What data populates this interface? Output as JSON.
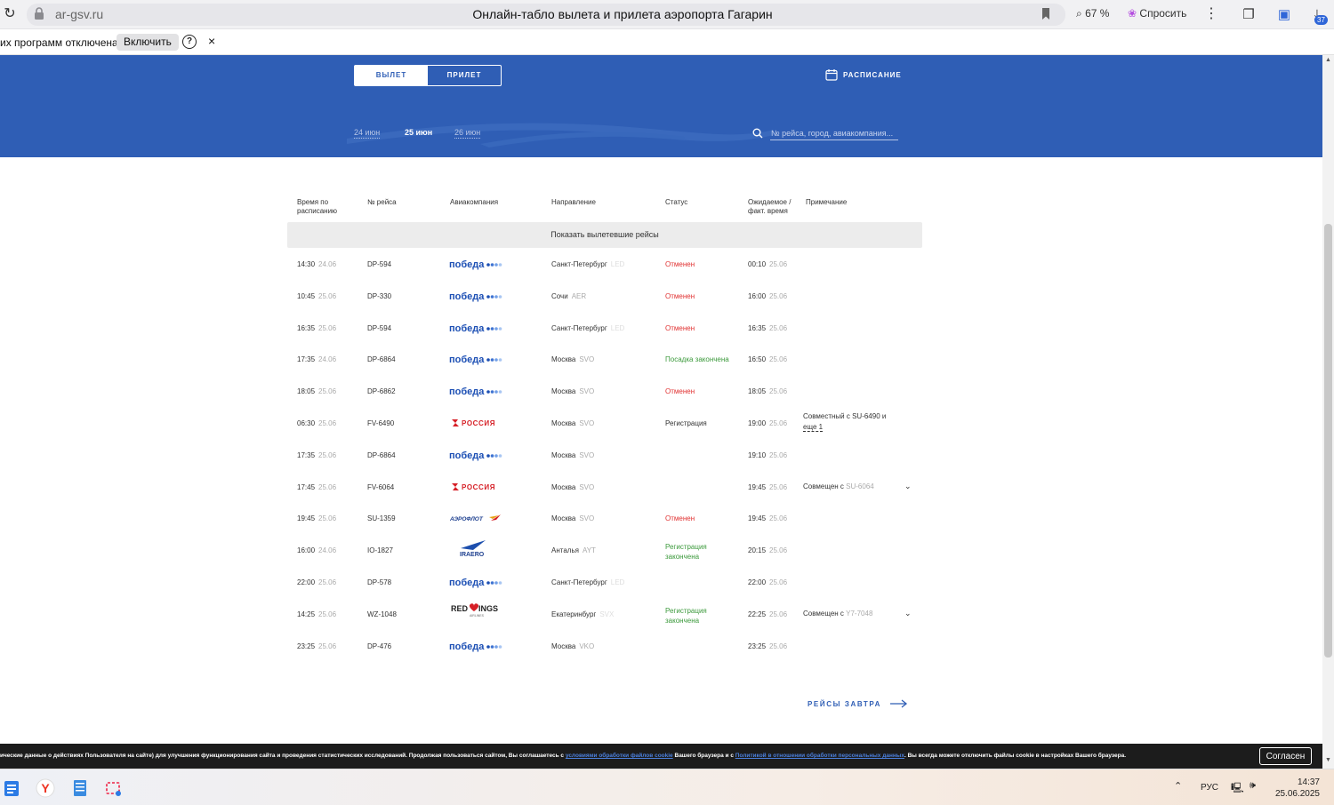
{
  "browser": {
    "domain": "ar-gsv.ru",
    "title": "Онлайн-табло вылета и прилета аэропорта Гагарин",
    "zoom": "67 %",
    "ask_label": "Спросить",
    "downloads_badge": "37"
  },
  "infobar": {
    "message": "их программ отключена",
    "enable_label": "Включить",
    "help": "?",
    "close": "×"
  },
  "header": {
    "tabs": [
      {
        "label": "ВЫЛЕТ",
        "active": true
      },
      {
        "label": "ПРИЛЕТ",
        "active": false
      }
    ],
    "schedule_label": "РАСПИСАНИЕ",
    "dates": [
      {
        "label": "24 июн",
        "current": false
      },
      {
        "label": "25 июн",
        "current": true
      },
      {
        "label": "26 июн",
        "current": false
      }
    ],
    "search_placeholder": "№ рейса, город, авиакомпания..."
  },
  "table": {
    "columns": {
      "scheduled_1": "Время по",
      "scheduled_2": "расписанию",
      "flight": "№ рейса",
      "airline": "Авиакомпания",
      "direction": "Направление",
      "status": "Статус",
      "expected_1": "Ожидаемое /",
      "expected_2": "факт. время",
      "note": "Примечание"
    },
    "show_departed": "Показать вылетевшие рейсы",
    "rows": [
      {
        "time": "14:30",
        "date": "24.06",
        "flight": "DP-594",
        "airline": "pobeda",
        "city": "Санкт-Петербург",
        "code": "LED",
        "status": "Отменен",
        "status_color": "red",
        "exp_time": "00:10",
        "exp_date": "25.06",
        "note": ""
      },
      {
        "time": "10:45",
        "date": "25.06",
        "flight": "DP-330",
        "airline": "pobeda",
        "city": "Сочи",
        "code": "AER",
        "status": "Отменен",
        "status_color": "red",
        "exp_time": "16:00",
        "exp_date": "25.06",
        "note": ""
      },
      {
        "time": "16:35",
        "date": "25.06",
        "flight": "DP-594",
        "airline": "pobeda",
        "city": "Санкт-Петербург",
        "code": "LED",
        "status": "Отменен",
        "status_color": "red",
        "exp_time": "16:35",
        "exp_date": "25.06",
        "note": ""
      },
      {
        "time": "17:35",
        "date": "24.06",
        "flight": "DP-6864",
        "airline": "pobeda",
        "city": "Москва",
        "code": "SVO",
        "status": "Посадка закончена",
        "status_color": "green",
        "exp_time": "16:50",
        "exp_date": "25.06",
        "note": ""
      },
      {
        "time": "18:05",
        "date": "25.06",
        "flight": "DP-6862",
        "airline": "pobeda",
        "city": "Москва",
        "code": "SVO",
        "status": "Отменен",
        "status_color": "red",
        "exp_time": "18:05",
        "exp_date": "25.06",
        "note": ""
      },
      {
        "time": "06:30",
        "date": "25.06",
        "flight": "FV-6490",
        "airline": "rossiya",
        "city": "Москва",
        "code": "SVO",
        "status": "Регистрация",
        "status_color": "dark",
        "exp_time": "19:00",
        "exp_date": "25.06",
        "note": "joint"
      },
      {
        "time": "17:35",
        "date": "25.06",
        "flight": "DP-6864",
        "airline": "pobeda",
        "city": "Москва",
        "code": "SVO",
        "status": "",
        "status_color": "dark",
        "exp_time": "19:10",
        "exp_date": "25.06",
        "note": ""
      },
      {
        "time": "17:45",
        "date": "25.06",
        "flight": "FV-6064",
        "airline": "rossiya",
        "city": "Москва",
        "code": "SVO",
        "status": "",
        "status_color": "dark",
        "exp_time": "19:45",
        "exp_date": "25.06",
        "note": "combined_su"
      },
      {
        "time": "19:45",
        "date": "25.06",
        "flight": "SU-1359",
        "airline": "aeroflot",
        "city": "Москва",
        "code": "SVO",
        "status": "Отменен",
        "status_color": "red",
        "exp_time": "19:45",
        "exp_date": "25.06",
        "note": ""
      },
      {
        "time": "16:00",
        "date": "24.06",
        "flight": "IO-1827",
        "airline": "iraero",
        "city": "Анталья",
        "code": "AYT",
        "status": "Регистрация",
        "status2": "закончена",
        "status_color": "green",
        "exp_time": "20:15",
        "exp_date": "25.06",
        "note": ""
      },
      {
        "time": "22:00",
        "date": "25.06",
        "flight": "DP-578",
        "airline": "pobeda",
        "city": "Санкт-Петербург",
        "code": "LED",
        "status": "",
        "status_color": "dark",
        "exp_time": "22:00",
        "exp_date": "25.06",
        "note": ""
      },
      {
        "time": "14:25",
        "date": "25.06",
        "flight": "WZ-1048",
        "airline": "redwings",
        "city": "Екатеринбург",
        "code": "SVX",
        "status": "Регистрация",
        "status2": "закончена",
        "status_color": "green",
        "exp_time": "22:25",
        "exp_date": "25.06",
        "note": "combined_y7"
      },
      {
        "time": "23:25",
        "date": "25.06",
        "flight": "DP-476",
        "airline": "pobeda",
        "city": "Москва",
        "code": "VKO",
        "status": "",
        "status_color": "dark",
        "exp_time": "23:25",
        "exp_date": "25.06",
        "note": ""
      }
    ],
    "notes": {
      "joint_1": "Совместный с SU-6490  и",
      "joint_2": "еще 1",
      "combined_prefix": "Совмещен с",
      "combined_su": "SU-6064",
      "combined_y7": "Y7-7048"
    },
    "logos": {
      "pobeda": "победа",
      "rossiya": "РОССИЯ",
      "aeroflot": "АЭРОФЛОТ",
      "iraero": "IRAERO",
      "redwings_1": "RED",
      "redwings_2": "INGS",
      "redwings_sub": "AIRLINES"
    }
  },
  "tomorrow_label": "РЕЙСЫ ЗАВТРА",
  "cookie": {
    "text_1": "ические данные о действиях Пользователя на сайте) для улучшения функционирования сайта и проведения статистических исследований. Продолжая пользоваться сайтом, Вы соглашаетесь с ",
    "link_1": "условиями обработки файлов cookie",
    "text_2": " Вашего браузера и с ",
    "link_2": "Политикой в отношении обработки персональных данных",
    "text_3": ". Вы всегда можете отключить файлы cookie в настройках Вашего браузера.",
    "agree_label": "Согласен"
  },
  "taskbar": {
    "lang": "РУС",
    "time": "14:37",
    "date": "25.06.2025"
  },
  "colors": {
    "brand_blue": "#2f5eb5",
    "cancel_red": "#e03030",
    "ok_green": "#3c9a3c"
  }
}
